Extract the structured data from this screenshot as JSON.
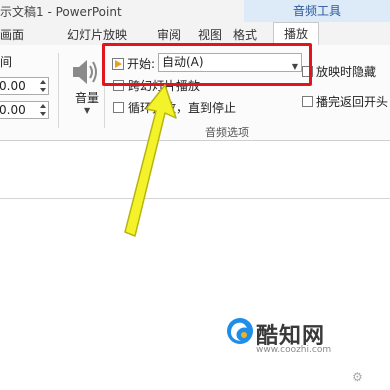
{
  "window": {
    "title": "示文稿1 - PowerPoint",
    "context_group": "音频工具"
  },
  "tabs": [
    {
      "label": "画面"
    },
    {
      "label": "幻灯片放映"
    },
    {
      "label": "审阅"
    },
    {
      "label": "视图"
    },
    {
      "label": "格式"
    },
    {
      "label": "播放"
    }
  ],
  "ribbon": {
    "left_label": "间",
    "fade_in_value": "0.00",
    "fade_out_value": "0.00",
    "volume_label": "音量",
    "start_label": "开始:",
    "start_select_value": "自动(A)",
    "cross_slides_label": "跨幻灯片播放",
    "loop_label": "循环播放，直到停止",
    "hide_label": "放映时隐藏",
    "rewind_label": "播完返回开头",
    "group_label": "音频选项"
  },
  "watermark": {
    "brand": "酷知网",
    "url": "www.coozhi.com"
  },
  "colors": {
    "highlight": "#e3141c",
    "arrow_fill": "#f4f32a",
    "arrow_stroke": "#b8b40f",
    "accent": "#2b579a"
  }
}
